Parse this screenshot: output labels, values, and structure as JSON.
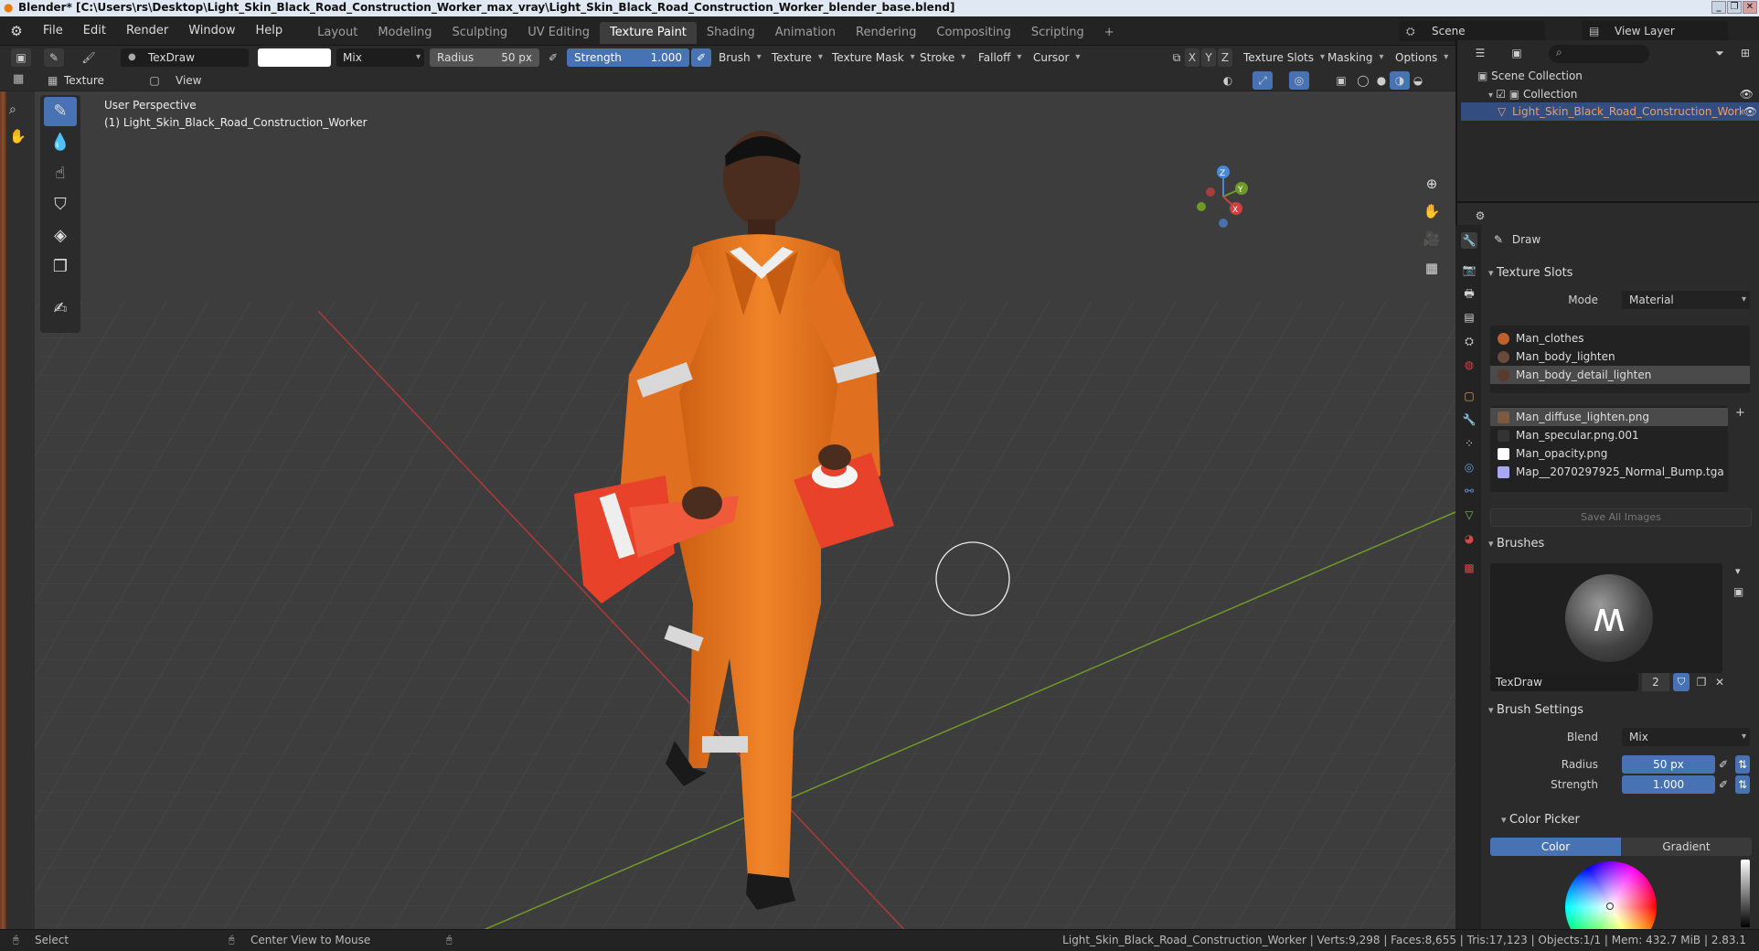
{
  "titlebar": {
    "text": "Blender* [C:\\Users\\rs\\Desktop\\Light_Skin_Black_Road_Construction_Worker_max_vray\\Light_Skin_Black_Road_Construction_Worker_blender_base.blend]",
    "min": "_",
    "max": "❐",
    "close": "✕"
  },
  "menu": {
    "items": [
      "File",
      "Edit",
      "Render",
      "Window",
      "Help"
    ]
  },
  "workspaces": [
    "Layout",
    "Modeling",
    "Sculpting",
    "UV Editing",
    "Texture Paint",
    "Shading",
    "Animation",
    "Rendering",
    "Compositing",
    "Scripting"
  ],
  "workspace_active": "Texture Paint",
  "workspace_add": "+",
  "scene": {
    "label": "Scene",
    "view_layer": "View Layer"
  },
  "toolheader": {
    "brush_name": "TexDraw",
    "blend": "Mix",
    "radius_label": "Radius",
    "radius_value": "50 px",
    "strength_label": "Strength",
    "strength_value": "1.000",
    "menus": [
      "Brush",
      "Texture",
      "Texture Mask",
      "Stroke",
      "Falloff",
      "Cursor"
    ],
    "axes": [
      "X",
      "Y",
      "Z"
    ],
    "texture_slots": "Texture Slots",
    "masking": "Masking",
    "options": "Options"
  },
  "header2": {
    "mode": "Texture Paint",
    "view": "View"
  },
  "viewport": {
    "perspective": "User Perspective",
    "object_line": "(1) Light_Skin_Black_Road_Construction_Worker",
    "gizmo": {
      "z": "Z",
      "y": "Y",
      "x": "X"
    }
  },
  "outliner": {
    "scene_collection": "Scene Collection",
    "collection": "Collection",
    "object": "Light_Skin_Black_Road_Construction_Worker"
  },
  "properties": {
    "tool_name": "Draw",
    "texture_slots_title": "Texture Slots",
    "mode_label": "Mode",
    "mode_value": "Material",
    "materials": [
      "Man_clothes",
      "Man_body_lighten",
      "Man_body_detail_lighten"
    ],
    "images": [
      "Man_diffuse_lighten.png",
      "Man_specular.png.001",
      "Man_opacity.png",
      "Map__2070297925_Normal_Bump.tga"
    ],
    "save_all": "Save All Images",
    "brushes_title": "Brushes",
    "brush_name": "TexDraw",
    "brush_users": "2",
    "brush_settings_title": "Brush Settings",
    "blend_label": "Blend",
    "blend_value": "Mix",
    "radius_label": "Radius",
    "radius_value": "50 px",
    "strength_label": "Strength",
    "strength_value": "1.000",
    "color_picker_title": "Color Picker",
    "color_tab": "Color",
    "gradient_tab": "Gradient"
  },
  "statusbar": {
    "select": "Select",
    "center": "Center View to Mouse",
    "stats": "Light_Skin_Black_Road_Construction_Worker | Verts:9,298 | Faces:8,655 | Tris:17,123 | Objects:1/1 | Mem: 432.7 MiB | 2.83.1"
  },
  "colors": {
    "accent": "#4772b3",
    "orange": "#e8781e",
    "cone": "#e8432a"
  }
}
